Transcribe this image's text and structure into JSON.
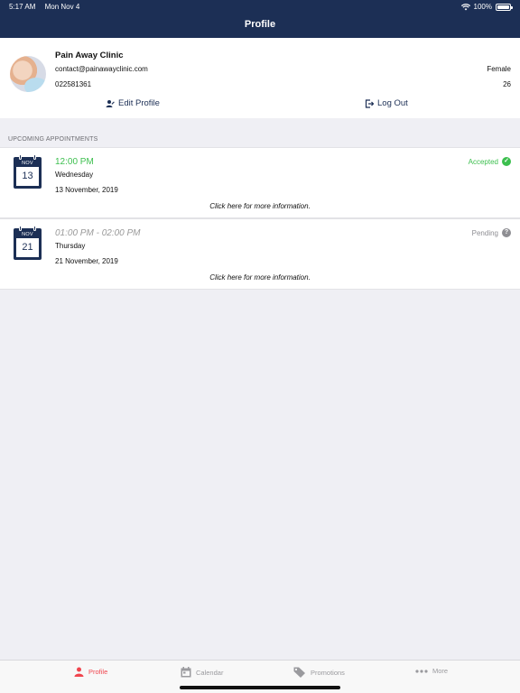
{
  "status_bar": {
    "time": "5:17 AM",
    "date": "Mon Nov 4",
    "battery": "100%"
  },
  "nav": {
    "title": "Profile"
  },
  "profile": {
    "name": "Pain Away Clinic",
    "email": "contact@painawayclinic.com",
    "phone": "022581361",
    "gender": "Female",
    "age": "26",
    "edit_label": "Edit Profile",
    "logout_label": "Log Out"
  },
  "appointments": {
    "header": "UPCOMING APPOINTMENTS",
    "items": [
      {
        "month": "NOV",
        "day_num": "13",
        "time": "12:00 PM",
        "weekday": "Wednesday",
        "date": "13 November, 2019",
        "status": "Accepted",
        "more": "Click here for more information."
      },
      {
        "month": "NOV",
        "day_num": "21",
        "time": "01:00 PM - 02:00 PM",
        "weekday": "Thursday",
        "date": "21 November, 2019",
        "status": "Pending",
        "more": "Click here for more information."
      }
    ]
  },
  "tabbar": {
    "tabs": [
      {
        "label": "Profile"
      },
      {
        "label": "Calendar"
      },
      {
        "label": "Promotions"
      },
      {
        "label": "More"
      }
    ]
  },
  "colors": {
    "navy": "#1c2f55",
    "accepted": "#3cbf4e",
    "pending": "#8e8e93",
    "active_tab": "#f0454e"
  }
}
